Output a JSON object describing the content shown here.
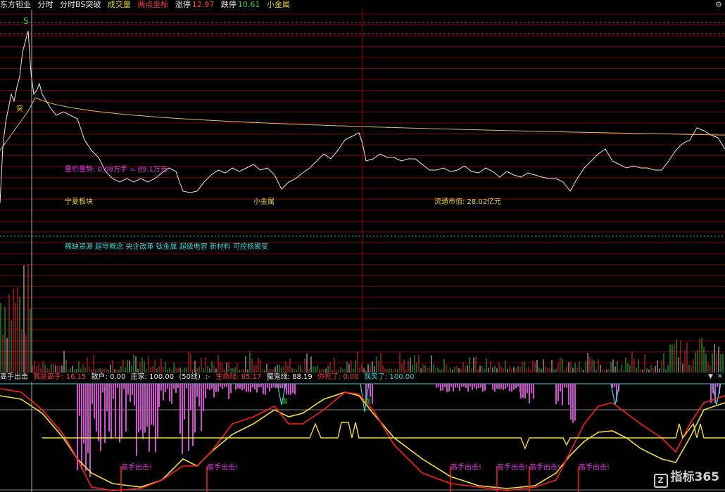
{
  "header": {
    "stock_name": "东方钽业",
    "mode_1": "分时",
    "mode_2": "分时BS突破",
    "volume_label": "成交量",
    "indicator_label": "两点坐标",
    "limit_up_label": "涨停",
    "limit_up_value": "12.97",
    "limit_down_label": "跌停",
    "limit_down_value": "10.61",
    "sector": "小金属",
    "settings_icon": "gear-icon"
  },
  "price_panel": {
    "signal_s": "S",
    "signal_tu": "突",
    "volume_trend": "量价量势: 0.08万手 = 89.1万元",
    "board": "宁夏板块",
    "sector": "小金属",
    "market_cap": "流通市值: 28.02亿元",
    "concepts": "稀缺资源 超导概念 央企改革 钛金属 超级电容 新材料 可控核聚变"
  },
  "indicator_bar": {
    "name": "高手出击",
    "wo_shi_gaoshou": "我是高手: 16.15",
    "sanhu": "散户: 0.00",
    "zhuangjia": "庄家: 100.00",
    "line50": "(50线)",
    "dash": ":-",
    "shengming": "生命线: 85.17",
    "mogui": "魔鬼线: 88.19",
    "ni_si_le": "你死了: 0.00",
    "wo_xiao_le": "我笑了: 100.00"
  },
  "indicator_panel": {
    "signal_text": "高手出击!",
    "hao_label": "高"
  },
  "watermark": {
    "text": "指标365",
    "logo_icon": "z-logo-icon"
  },
  "colors": {
    "grid_red": "#7a0000",
    "price_line": "#e8e8e8",
    "avg_line": "#d8c070",
    "vol_up": "#e63232",
    "vol_down": "#32c832",
    "vol_flat": "#d8d8d8",
    "magenta": "#d050d0",
    "cyan": "#3cd2d2",
    "yellow": "#f0e040",
    "red_line": "#ff2020"
  }
}
